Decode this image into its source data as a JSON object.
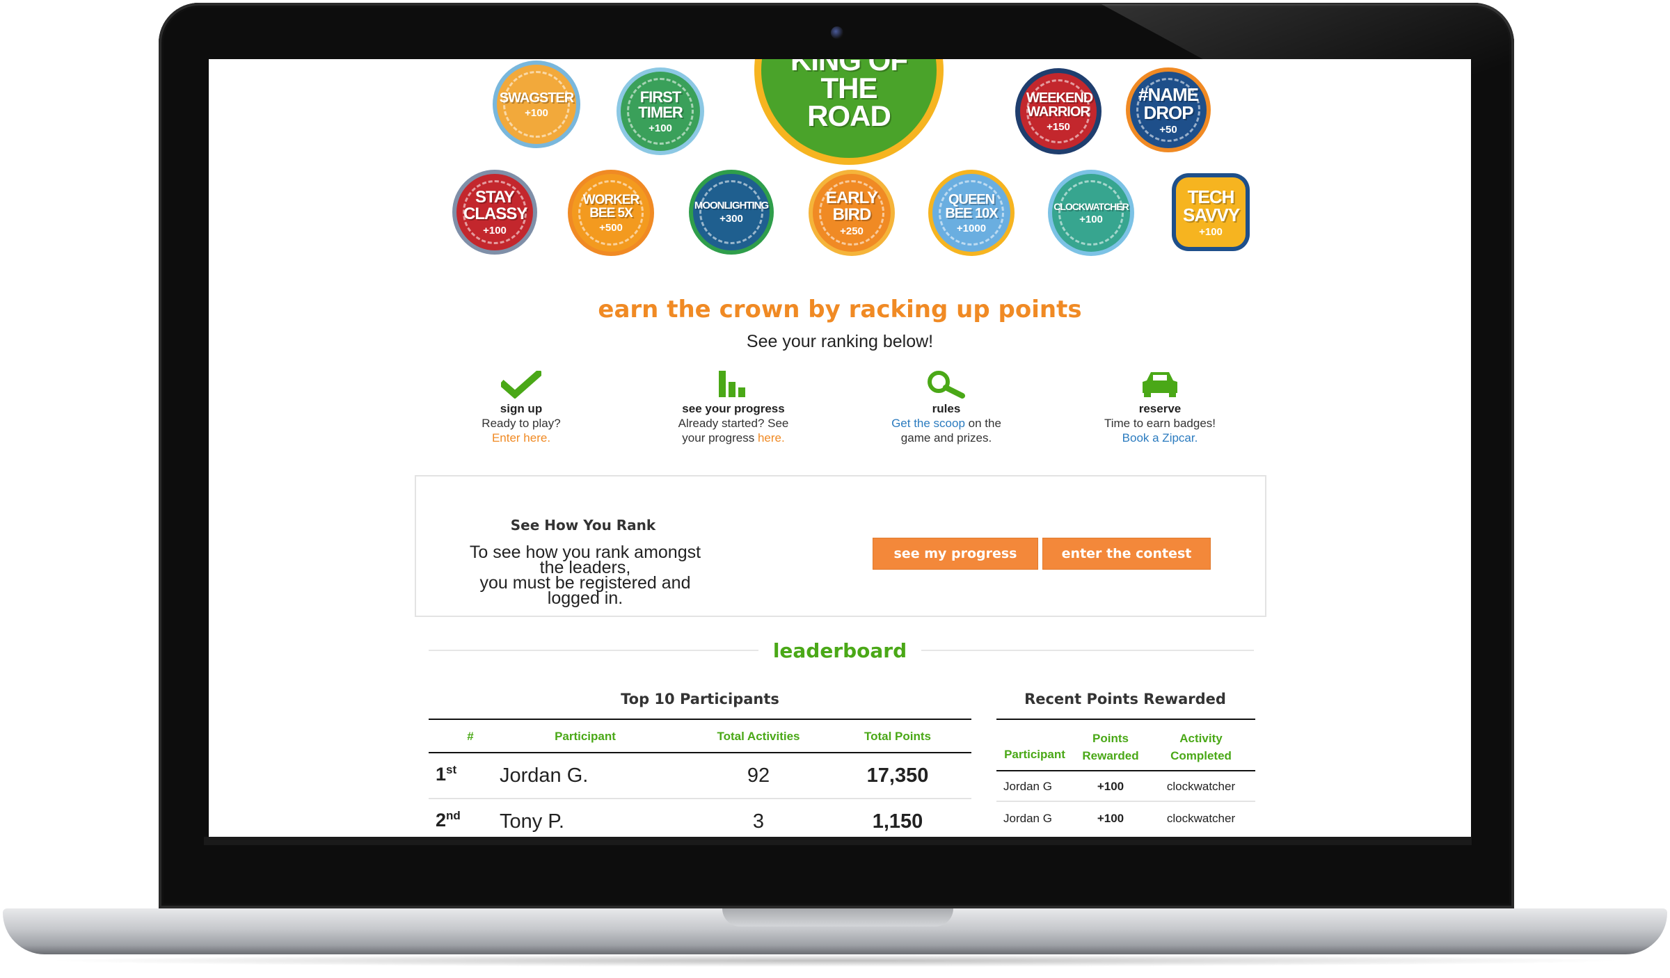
{
  "badges": {
    "row1": [
      {
        "name": "SWAGSTER",
        "points": "+100",
        "color": "#f2a93b",
        "ring": "#79b7dc"
      },
      {
        "name": "FIRST TIMER",
        "points": "+100",
        "color": "#3aa05a",
        "ring": "#8cc8e4"
      },
      {
        "name": "KING OF THE ROAD",
        "points": "",
        "color": "#4aa32a",
        "ring": "#f6b420"
      },
      {
        "name": "WEEKEND WARRIOR",
        "points": "+150",
        "color": "#c3272d",
        "ring": "#1f3e6e"
      },
      {
        "name": "#NAME DROP",
        "points": "+50",
        "color": "#1e4f8a",
        "ring": "#f08a24"
      }
    ],
    "row2": [
      {
        "name": "STAY CLASSY",
        "points": "+100",
        "color": "#c3272d",
        "ring": "#7f8fa8"
      },
      {
        "name": "WORKER BEE 5X",
        "points": "+500",
        "color": "#f39a1f",
        "ring": "#f08a24"
      },
      {
        "name": "MOONLIGHTING",
        "points": "+300",
        "color": "#1f5f8f",
        "ring": "#2f9e4b"
      },
      {
        "name": "EARLY BIRD",
        "points": "+250",
        "color": "#f08a24",
        "ring": "#f5b43a"
      },
      {
        "name": "QUEEN BEE 10X",
        "points": "+1000",
        "color": "#6aaee0",
        "ring": "#f6b420"
      },
      {
        "name": "CLOCKWATCHER",
        "points": "+100",
        "color": "#37a58f",
        "ring": "#7cc2e5"
      },
      {
        "name": "TECH SAVVY",
        "points": "+100",
        "color": "#f6b420",
        "ring": "#1e4f8a"
      }
    ]
  },
  "headline": "earn the crown by racking up points",
  "subhead": "See your ranking below!",
  "steps": [
    {
      "icon": "checkmark-icon",
      "title": "sign up",
      "line1": "Ready to play?",
      "link": "Enter here.",
      "after": ""
    },
    {
      "icon": "bar-chart-icon",
      "title": "see your progress",
      "line1": "Already started? See",
      "line2": "your progress ",
      "link": "here."
    },
    {
      "icon": "magnifier-icon",
      "title": "rules",
      "link": "Get the scoop",
      "line1": " on the",
      "line2": "game and prizes."
    },
    {
      "icon": "car-icon",
      "title": "reserve",
      "line1": "Time to earn badges!",
      "link": "Book a Zipcar."
    }
  ],
  "rank": {
    "title": "See How You Rank",
    "text1": "To see how you rank amongst the leaders,",
    "text2": "you must be registered and logged in.",
    "btn_progress": "see my progress",
    "btn_contest": "enter the contest"
  },
  "leaderboard": {
    "title": "leaderboard",
    "top10": {
      "caption": "Top 10 Participants",
      "headers": [
        "#",
        "Participant",
        "Total Activities",
        "Total Points"
      ],
      "rows": [
        {
          "rank": "1",
          "suffix": "st",
          "name": "Jordan G.",
          "activities": "92",
          "points": "17,350"
        },
        {
          "rank": "2",
          "suffix": "nd",
          "name": "Tony P.",
          "activities": "3",
          "points": "1,150"
        }
      ]
    },
    "recent": {
      "caption": "Recent Points Rewarded",
      "headers": [
        "Participant",
        "Points Rewarded",
        "Activity Completed"
      ],
      "h_points_1": "Points",
      "h_points_2": "Rewarded",
      "h_activity_1": "Activity",
      "h_activity_2": "Completed",
      "rows": [
        {
          "name": "Jordan G",
          "points": "+100",
          "activity": "clockwatcher"
        },
        {
          "name": "Jordan G",
          "points": "+100",
          "activity": "clockwatcher"
        }
      ]
    }
  }
}
